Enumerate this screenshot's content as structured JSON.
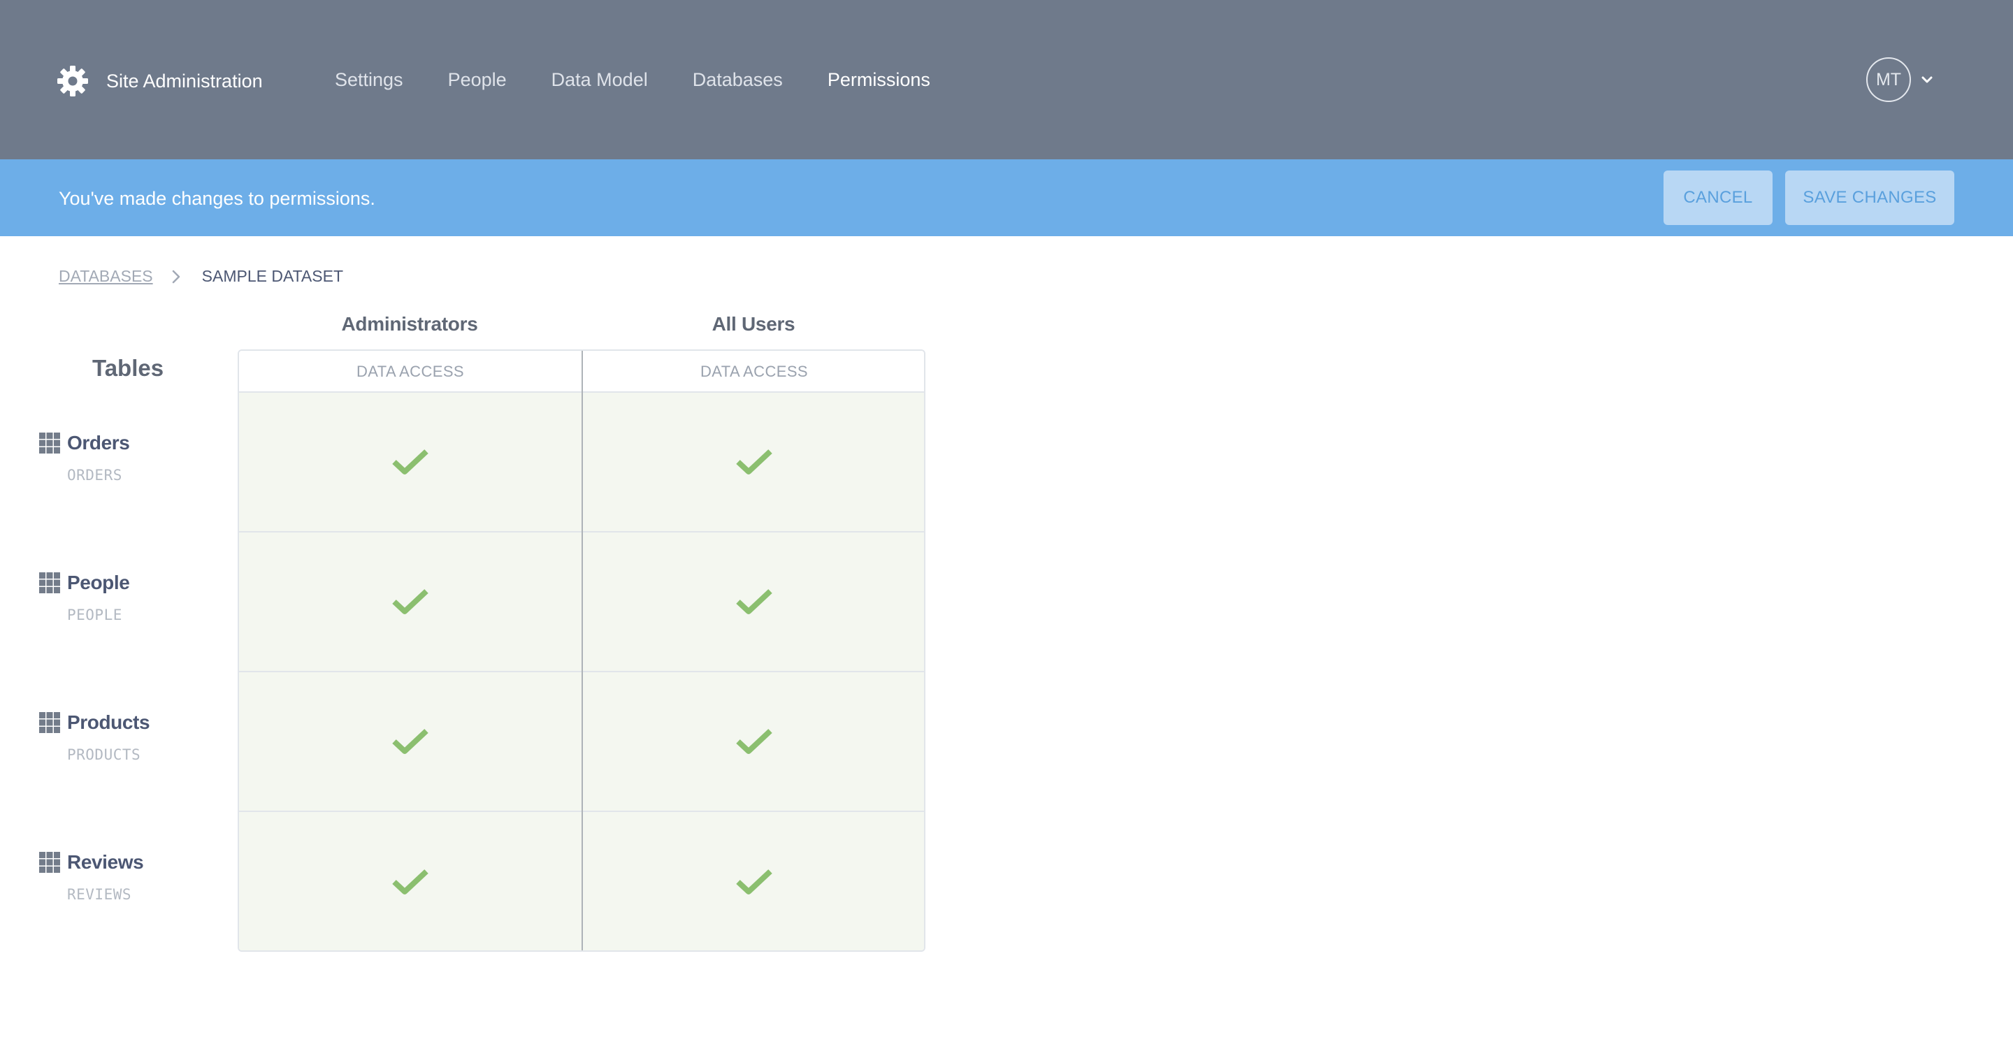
{
  "nav": {
    "brand_title": "Site Administration",
    "links": [
      {
        "label": "Settings"
      },
      {
        "label": "People"
      },
      {
        "label": "Data Model"
      },
      {
        "label": "Databases"
      },
      {
        "label": "Permissions"
      }
    ],
    "active_link": "Permissions",
    "avatar_initials": "MT"
  },
  "banner": {
    "message": "You've made changes to permissions.",
    "cancel_label": "CANCEL",
    "save_label": "SAVE CHANGES"
  },
  "breadcrumb": {
    "parent": "DATABASES",
    "current": "SAMPLE DATASET"
  },
  "grid": {
    "tables_heading": "Tables",
    "groups": [
      {
        "name": "Administrators",
        "column_label": "DATA ACCESS"
      },
      {
        "name": "All Users",
        "column_label": "DATA ACCESS"
      }
    ],
    "rows": [
      {
        "name": "Orders",
        "table": "ORDERS",
        "access": [
          "granted",
          "granted"
        ]
      },
      {
        "name": "People",
        "table": "PEOPLE",
        "access": [
          "granted",
          "granted"
        ]
      },
      {
        "name": "Products",
        "table": "PRODUCTS",
        "access": [
          "granted",
          "granted"
        ]
      },
      {
        "name": "Reviews",
        "table": "REVIEWS",
        "access": [
          "granted",
          "granted"
        ]
      }
    ]
  },
  "colors": {
    "nav_bg": "#6f7a8b",
    "banner_bg": "#6daee8",
    "granted_check": "#8bbf6f",
    "cell_bg": "#f4f7f0"
  },
  "icons": {
    "settings": "gear-icon",
    "table": "table-grid-icon",
    "granted": "checkmark-icon",
    "account_menu": "chevron-down-icon",
    "breadcrumb_separator": "chevron-right-icon"
  }
}
